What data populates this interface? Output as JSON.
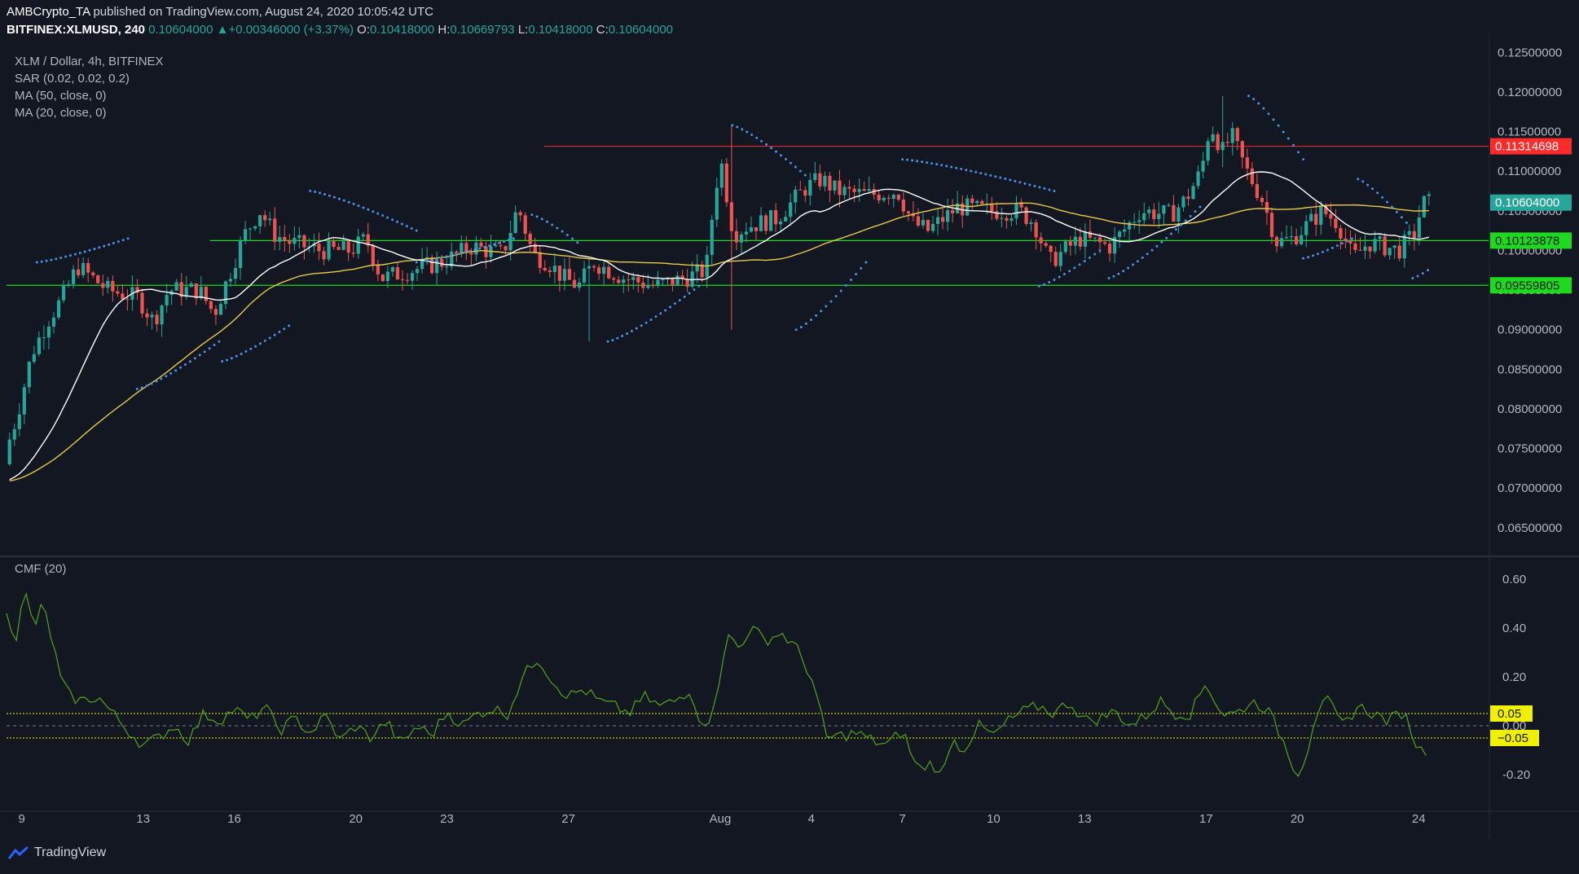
{
  "header": {
    "publisher": "AMBCrypto_TA",
    "published_text": "published on TradingView.com, August 24, 2020 10:05:42 UTC",
    "symbol": "BITFINEX:XLMUSD, 240",
    "last": "0.10604000",
    "change": "+0.00346000 (+3.37%)",
    "open_label": "O:",
    "open": "0.10418000",
    "high_label": "H:",
    "high": "0.10669793",
    "low_label": "L:",
    "low": "0.10418000",
    "close_label": "C:",
    "close": "0.10604000"
  },
  "legend": {
    "title": "XLM / Dollar, 4h, BITFINEX",
    "sar": "SAR (0.02, 0.02, 0.2)",
    "ma50": "MA (50, close, 0)",
    "ma20": "MA (20, close, 0)",
    "cmf": "CMF (20)"
  },
  "branding": {
    "name": "TradingView",
    "icon": "tradingview-logo-icon"
  },
  "colors": {
    "background": "#131722",
    "up": "#26a69a",
    "down": "#ef5350",
    "ma20": "#ffffff",
    "ma50": "#e6c94a",
    "sar": "#4a90e2",
    "cmf": "#4e9a1c",
    "resistance": "#ff2a2a",
    "support": "#1ed91e",
    "cmf_level": "#f0f000"
  },
  "chart_data": [
    {
      "type": "candlestick",
      "title": "XLM / Dollar, 4h, BITFINEX",
      "x_ticks": [
        "9",
        "13",
        "16",
        "20",
        "23",
        "27",
        "Aug",
        "4",
        "7",
        "10",
        "13",
        "17",
        "20",
        "24"
      ],
      "x_tick_days": [
        9,
        13,
        16,
        20,
        23,
        27,
        32,
        35,
        38,
        41,
        44,
        48,
        51,
        55
      ],
      "x_range_days": [
        8.5,
        57.3
      ],
      "y_ticks": [
        "0.12500000",
        "0.12000000",
        "0.11500000",
        "0.11000000",
        "0.10500000",
        "0.10000000",
        "0.09500000",
        "0.09000000",
        "0.08500000",
        "0.08000000",
        "0.07500000",
        "0.07000000",
        "0.06500000"
      ],
      "ylim": [
        0.062,
        0.1275
      ],
      "price_path_days": [
        8.5,
        9,
        9.5,
        10,
        10.5,
        11,
        12,
        13,
        13.5,
        14,
        15,
        15.5,
        16,
        16.5,
        17,
        17.5,
        18,
        19,
        20,
        20.5,
        21,
        22,
        23,
        24,
        25,
        25.5,
        26,
        26.5,
        27,
        27.5,
        28,
        29,
        30,
        31,
        31.7,
        32,
        32.2,
        32.6,
        33,
        34,
        35,
        35.5,
        36,
        37,
        38,
        38.5,
        39,
        40,
        41,
        42,
        42.5,
        43,
        43.5,
        44,
        45,
        46,
        47,
        47.5,
        48,
        48.3,
        48.7,
        49,
        49.5,
        50,
        50.5,
        51,
        52,
        52.5,
        53,
        53.5,
        54,
        54.5,
        55,
        55.3
      ],
      "price_path": [
        0.073,
        0.079,
        0.087,
        0.091,
        0.094,
        0.098,
        0.095,
        0.094,
        0.091,
        0.095,
        0.095,
        0.092,
        0.097,
        0.102,
        0.105,
        0.102,
        0.101,
        0.1,
        0.1,
        0.1015,
        0.0965,
        0.0975,
        0.0985,
        0.1005,
        0.0995,
        0.1055,
        0.0995,
        0.0985,
        0.0965,
        0.0955,
        0.0985,
        0.0965,
        0.0955,
        0.0965,
        0.0975,
        0.108,
        0.111,
        0.102,
        0.103,
        0.104,
        0.108,
        0.109,
        0.1075,
        0.107,
        0.1075,
        0.1035,
        0.1025,
        0.1055,
        0.105,
        0.105,
        0.1035,
        0.0985,
        0.1,
        0.1015,
        0.1005,
        0.105,
        0.1045,
        0.1065,
        0.11,
        0.116,
        0.1125,
        0.1145,
        0.11,
        0.1065,
        0.101,
        0.1015,
        0.105,
        0.1035,
        0.099,
        0.101,
        0.1005,
        0.1,
        0.102,
        0.106
      ],
      "resistance": {
        "value": 0.11314698,
        "label": "0.11314698",
        "from_day": 26.2
      },
      "supports": [
        {
          "value": 0.10123878,
          "label": "0.10123878",
          "from_day": 15.2
        },
        {
          "value": 0.09559805,
          "label": "0.09559805",
          "from_day": 8.5
        }
      ],
      "last_price_label": "0.10604000",
      "wick_extremes": [
        {
          "day": 32.3,
          "high": 0.1158,
          "low": 0.09
        },
        {
          "day": 48.6,
          "high": 0.1195,
          "low": 0.1105
        },
        {
          "day": 27.7,
          "high": 0.0982,
          "low": 0.0885
        }
      ],
      "sar_segments": [
        {
          "from_day": 9.5,
          "to_day": 12.5,
          "start": 0.0985,
          "end": 0.1015
        },
        {
          "from_day": 12.8,
          "to_day": 15.5,
          "start": 0.0825,
          "end": 0.0885
        },
        {
          "from_day": 15.6,
          "to_day": 17.8,
          "start": 0.086,
          "end": 0.0905
        },
        {
          "from_day": 18.5,
          "to_day": 22.0,
          "start": 0.1075,
          "end": 0.1025
        },
        {
          "from_day": 22.0,
          "to_day": 25.2,
          "start": 0.0985,
          "end": 0.1015
        },
        {
          "from_day": 25.8,
          "to_day": 27.3,
          "start": 0.1045,
          "end": 0.101
        },
        {
          "from_day": 28.3,
          "to_day": 31.3,
          "start": 0.0885,
          "end": 0.0955
        },
        {
          "from_day": 32.4,
          "to_day": 34.8,
          "start": 0.1158,
          "end": 0.1095
        },
        {
          "from_day": 34.5,
          "to_day": 36.8,
          "start": 0.09,
          "end": 0.0985
        },
        {
          "from_day": 38.0,
          "to_day": 43.0,
          "start": 0.1115,
          "end": 0.1075
        },
        {
          "from_day": 42.5,
          "to_day": 44.5,
          "start": 0.0955,
          "end": 0.1
        },
        {
          "from_day": 44.8,
          "to_day": 47.8,
          "start": 0.0965,
          "end": 0.1055
        },
        {
          "from_day": 49.4,
          "to_day": 51.2,
          "start": 0.1195,
          "end": 0.1115
        },
        {
          "from_day": 51.2,
          "to_day": 52.8,
          "start": 0.099,
          "end": 0.1015
        },
        {
          "from_day": 53.0,
          "to_day": 54.6,
          "start": 0.109,
          "end": 0.1035
        },
        {
          "from_day": 54.8,
          "to_day": 55.3,
          "start": 0.0965,
          "end": 0.0975
        }
      ]
    },
    {
      "type": "line",
      "title": "CMF (20)",
      "y_ticks": [
        "0.60",
        "0.40",
        "0.20",
        "0.00",
        "-0.20"
      ],
      "y_tick_values": [
        0.6,
        0.4,
        0.2,
        0.0,
        -0.2
      ],
      "ylim": [
        -0.33,
        0.67
      ],
      "levels": [
        {
          "value": 0.05,
          "label": "0.05"
        },
        {
          "value": -0.05,
          "label": "−0.05"
        }
      ],
      "x_days": [
        8.5,
        8.8,
        9.1,
        9.4,
        9.7,
        10,
        10.3,
        10.6,
        11,
        11.5,
        12,
        12.5,
        13,
        13.5,
        14,
        14.5,
        15,
        15.5,
        16,
        16.5,
        17,
        17.5,
        18,
        18.5,
        19,
        19.5,
        20,
        20.5,
        21,
        21.5,
        22,
        22.5,
        23,
        23.5,
        24,
        24.5,
        25,
        25.5,
        26,
        26.5,
        27,
        27.5,
        28,
        28.5,
        29,
        29.5,
        30,
        30.5,
        31,
        31.5,
        32,
        32.3,
        32.6,
        33,
        33.5,
        34,
        34.5,
        35,
        35.5,
        36,
        36.5,
        37,
        37.5,
        38,
        38.5,
        39,
        39.3,
        39.6,
        40,
        40.5,
        41,
        41.5,
        42,
        42.5,
        43,
        43.5,
        44,
        44.5,
        45,
        45.5,
        46,
        46.5,
        47,
        47.5,
        48,
        48.5,
        49,
        49.5,
        50,
        50.5,
        51,
        51.3,
        51.6,
        52,
        52.5,
        53,
        53.5,
        54,
        54.5,
        55,
        55.3
      ],
      "values": [
        0.48,
        0.35,
        0.55,
        0.4,
        0.5,
        0.35,
        0.18,
        0.12,
        0.1,
        0.12,
        0.05,
        -0.02,
        -0.08,
        -0.05,
        0.0,
        -0.06,
        0.05,
        0.02,
        0.07,
        0.02,
        0.08,
        -0.02,
        0.03,
        -0.03,
        0.04,
        -0.06,
        0.0,
        -0.05,
        0.02,
        -0.08,
        0.0,
        -0.04,
        0.06,
        0.0,
        0.05,
        0.07,
        0.05,
        0.2,
        0.28,
        0.18,
        0.12,
        0.15,
        0.1,
        0.08,
        0.05,
        0.12,
        0.08,
        0.1,
        0.15,
        -0.03,
        0.2,
        0.38,
        0.32,
        0.4,
        0.35,
        0.38,
        0.32,
        0.2,
        -0.05,
        -0.04,
        -0.03,
        -0.06,
        -0.08,
        -0.02,
        -0.18,
        -0.15,
        -0.22,
        -0.05,
        -0.1,
        0.0,
        -0.04,
        0.02,
        0.06,
        0.08,
        0.05,
        0.1,
        0.02,
        0.03,
        0.06,
        0.0,
        0.04,
        0.1,
        0.05,
        0.05,
        0.18,
        0.05,
        0.05,
        0.1,
        0.07,
        -0.05,
        -0.2,
        -0.12,
        0.05,
        0.1,
        0.0,
        0.08,
        0.05,
        0.02,
        0.06,
        -0.1,
        -0.1
      ]
    }
  ]
}
